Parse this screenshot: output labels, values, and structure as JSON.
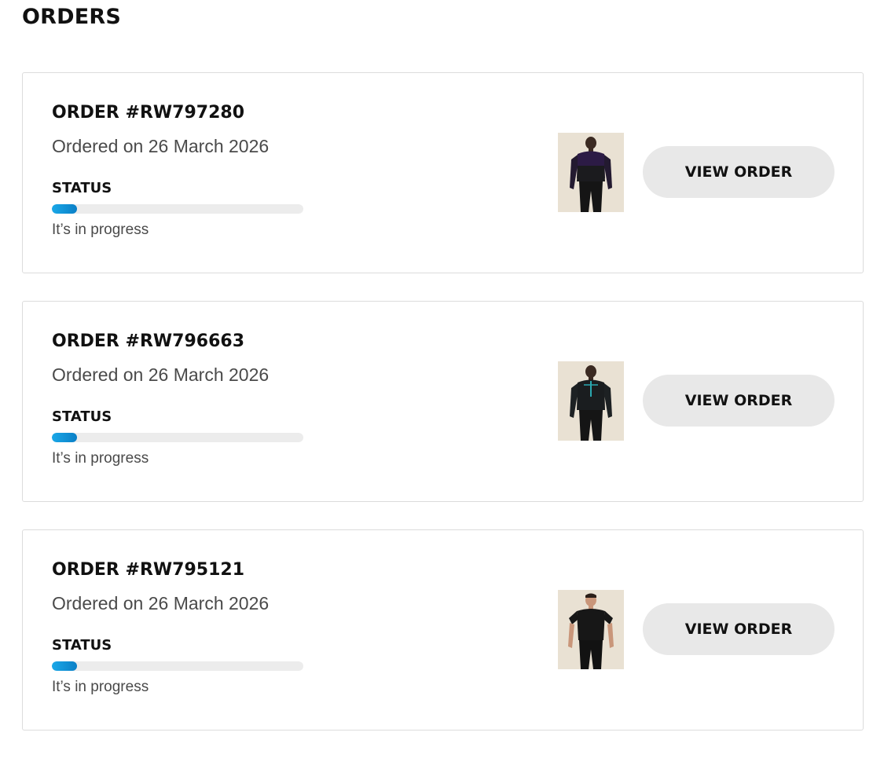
{
  "page": {
    "title": "ORDERS"
  },
  "orders": [
    {
      "number": "ORDER #RW797280",
      "date": "Ordered on 26 March 2026",
      "status_label": "STATUS",
      "status_text": "It’s in progress",
      "progress_percent": 10,
      "button_label": "VIEW ORDER",
      "product_image": "man-purple-black-hoodie-photo"
    },
    {
      "number": "ORDER #RW796663",
      "date": "Ordered on 26 March 2026",
      "status_label": "STATUS",
      "status_text": "It’s in progress",
      "progress_percent": 10,
      "button_label": "VIEW ORDER",
      "product_image": "man-black-teal-zip-top-photo"
    },
    {
      "number": "ORDER #RW795121",
      "date": "Ordered on 26 March 2026",
      "status_label": "STATUS",
      "status_text": "It’s in progress",
      "progress_percent": 10,
      "button_label": "VIEW ORDER",
      "product_image": "man-black-tshirt-photo"
    }
  ],
  "colors": {
    "progress_fill": "#0a8fd6",
    "progress_track": "#ececec",
    "button_bg": "#e8e8e8",
    "card_border": "#dcdcdc"
  }
}
